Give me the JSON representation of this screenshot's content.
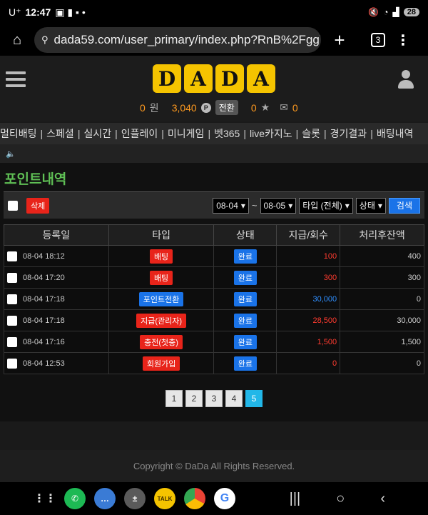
{
  "status_bar": {
    "carrier": "U⁺",
    "time": "12:47",
    "battery": "28"
  },
  "browser": {
    "url": "dada59.com/user_primary/index.php?RnB%2FggY",
    "tab_count": "3"
  },
  "header": {
    "logo_letters": [
      "D",
      "A",
      "D",
      "A"
    ],
    "cash_value": "0",
    "cash_unit": "원",
    "points_value": "3,040",
    "points_badge": "P",
    "switch_label": "전환",
    "favorites_count": "0",
    "messages_count": "0"
  },
  "nav": {
    "items": [
      "멀티배팅",
      "스페셜",
      "실시간",
      "인플레이",
      "미니게임",
      "벳365",
      "live카지노",
      "슬롯",
      "경기결과",
      "배팅내역"
    ]
  },
  "page": {
    "title": "포인트내역",
    "delete_label": "삭제",
    "date_from": "08-04",
    "date_to": "08-05",
    "date_separator": "~",
    "type_filter": "타입 (전체)",
    "status_filter": "상태",
    "search_label": "검색"
  },
  "table": {
    "headers": [
      "등록일",
      "타입",
      "상태",
      "지급/회수",
      "처리후잔액"
    ],
    "rows": [
      {
        "date": "08-04 18:12",
        "type": "배팅",
        "type_color": "#e8241a",
        "status": "완료",
        "amount": "100",
        "amount_color": "#ff3b2f",
        "balance": "400"
      },
      {
        "date": "08-04 17:20",
        "type": "배팅",
        "type_color": "#e8241a",
        "status": "완료",
        "amount": "300",
        "amount_color": "#ff3b2f",
        "balance": "300"
      },
      {
        "date": "08-04 17:18",
        "type": "포인트전환",
        "type_color": "#1a73e8",
        "status": "완료",
        "amount": "30,000",
        "amount_color": "#2f8fff",
        "balance": "0"
      },
      {
        "date": "08-04 17:18",
        "type": "지급(관리자)",
        "type_color": "#e8241a",
        "status": "완료",
        "amount": "28,500",
        "amount_color": "#ff3b2f",
        "balance": "30,000"
      },
      {
        "date": "08-04 17:16",
        "type": "충전(첫충)",
        "type_color": "#e8241a",
        "status": "완료",
        "amount": "1,500",
        "amount_color": "#ff3b2f",
        "balance": "1,500"
      },
      {
        "date": "08-04 12:53",
        "type": "회원가입",
        "type_color": "#e8241a",
        "status": "완료",
        "amount": "0",
        "amount_color": "#ff3b2f",
        "balance": "0"
      }
    ]
  },
  "pagination": {
    "pages": [
      "1",
      "2",
      "3",
      "4",
      "5"
    ],
    "active": "5"
  },
  "footer": {
    "copyright": "Copyright © DaDa All Rights Reserved."
  },
  "dock": {
    "kakao_label": "TALK"
  }
}
